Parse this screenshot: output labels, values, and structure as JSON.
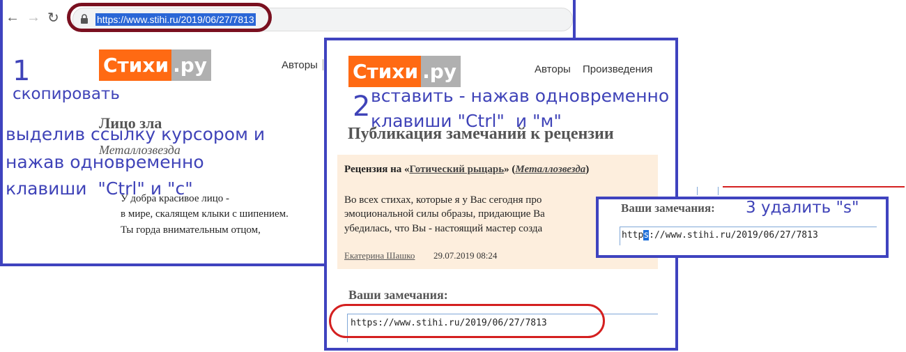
{
  "browser": {
    "url": "https://www.stihi.ru/2019/06/27/7813"
  },
  "site": {
    "logo_main": "Стихи",
    "logo_tld": ".ру",
    "nav_authors": "Авторы",
    "nav_works": "Произведения"
  },
  "poem": {
    "title": "Лицо зла",
    "author": "Металлозвезда",
    "lines": [
      "У добра красивое лицо -",
      "в мире, скалящем клыки с шипением.",
      "Ты горда внимательным отцом,"
    ]
  },
  "review_page": {
    "heading": "Публикация замечаний к рецензии",
    "review_prefix": "Рецензия на «",
    "review_work": "Готический рыцарь",
    "review_mid": "» (",
    "review_author": "Металлозвезда",
    "review_suffix": ")",
    "review_body": [
      "Во всех стихах, которые я у Вас сегодня про",
      "эмоциональной силы образы, придающие Ва",
      "убедилась, что Вы - настоящий мастер созда"
    ],
    "reviewer": "Екатерина Шашко",
    "review_date": "29.07.2019 08:24",
    "remarks_label": "Ваши замечания:",
    "remarks_value": "https://www.stihi.ru/2019/06/27/7813"
  },
  "zoom_panel": {
    "remarks_label": "Ваши замечания:",
    "value_before": "http",
    "value_selected": "s",
    "value_after": "://www.stihi.ru/2019/06/27/7813"
  },
  "annotations": {
    "step1_number": "1",
    "step1_title": "скопировать",
    "step1_line1": "выделив ссылку курсором и",
    "step1_line2": "нажав одновременно",
    "step1_line3": "клавиши  \"Ctrl\" и \"c\"",
    "step2_number": "2",
    "step2_line1": "вставить - нажав одновременно",
    "step2_line2": "клавиши \"Ctrl\"  и \"м\"",
    "step3_text": "3 удалить \"s\""
  },
  "colors": {
    "frame": "#3f43bf",
    "annotation": "#3f43b8",
    "logo_orange": "#ff6a13",
    "logo_grey": "#b0b0b0",
    "review_bg": "#fdeedd",
    "highlight_red": "#d42020",
    "url_oval": "#7a1020",
    "selection": "#1e6fd9"
  }
}
